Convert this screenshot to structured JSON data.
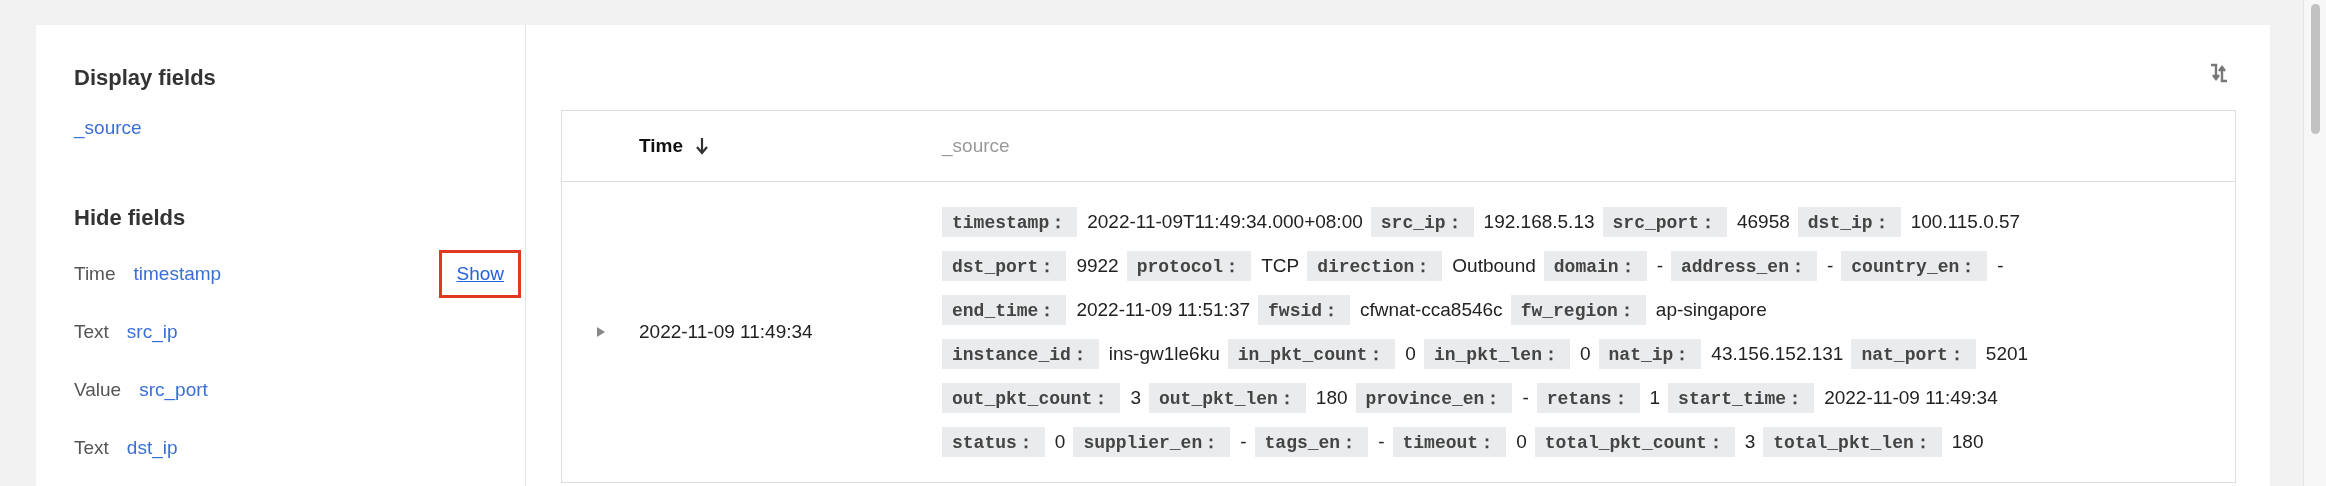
{
  "sidebar": {
    "display_heading": "Display fields",
    "display_fields": [
      {
        "name": "_source"
      }
    ],
    "hide_heading": "Hide fields",
    "hide_fields": [
      {
        "type": "Time",
        "name": "timestamp",
        "action": "Show",
        "highlighted": true
      },
      {
        "type": "Text",
        "name": "src_ip"
      },
      {
        "type": "Value",
        "name": "src_port"
      },
      {
        "type": "Text",
        "name": "dst_ip"
      }
    ]
  },
  "table": {
    "columns": [
      {
        "label": "Time",
        "sorted": true
      },
      {
        "label": "_source",
        "sorted": false
      }
    ],
    "rows": [
      {
        "expanded": false,
        "time": "2022-11-09 11:49:34",
        "source_lines": [
          [
            {
              "key": "timestamp：",
              "value": "2022-11-09T11:49:34.000+08:00"
            },
            {
              "key": "src_ip：",
              "value": "192.168.5.13"
            },
            {
              "key": "src_port：",
              "value": "46958"
            },
            {
              "key": "dst_ip：",
              "value": "100.115.0.57"
            }
          ],
          [
            {
              "key": "dst_port：",
              "value": "9922"
            },
            {
              "key": "protocol：",
              "value": "TCP"
            },
            {
              "key": "direction：",
              "value": "Outbound"
            },
            {
              "key": "domain：",
              "value": "-"
            },
            {
              "key": "address_en：",
              "value": "-"
            },
            {
              "key": "country_en：",
              "value": "-"
            }
          ],
          [
            {
              "key": "end_time：",
              "value": "2022-11-09 11:51:37"
            },
            {
              "key": "fwsid：",
              "value": "cfwnat-cca8546c"
            },
            {
              "key": "fw_region：",
              "value": "ap-singapore"
            }
          ],
          [
            {
              "key": "instance_id：",
              "value": "ins-gw1le6ku"
            },
            {
              "key": "in_pkt_count：",
              "value": "0"
            },
            {
              "key": "in_pkt_len：",
              "value": "0"
            },
            {
              "key": "nat_ip：",
              "value": "43.156.152.131"
            },
            {
              "key": "nat_port：",
              "value": "5201"
            }
          ],
          [
            {
              "key": "out_pkt_count：",
              "value": "3"
            },
            {
              "key": "out_pkt_len：",
              "value": "180"
            },
            {
              "key": "province_en：",
              "value": "-"
            },
            {
              "key": "retans：",
              "value": "1"
            },
            {
              "key": "start_time：",
              "value": "2022-11-09 11:49:34"
            }
          ],
          [
            {
              "key": "status：",
              "value": "0"
            },
            {
              "key": "supplier_en：",
              "value": "-"
            },
            {
              "key": "tags_en：",
              "value": "-"
            },
            {
              "key": "timeout：",
              "value": "0"
            },
            {
              "key": "total_pkt_count：",
              "value": "3"
            },
            {
              "key": "total_pkt_len：",
              "value": "180"
            }
          ]
        ]
      }
    ]
  }
}
